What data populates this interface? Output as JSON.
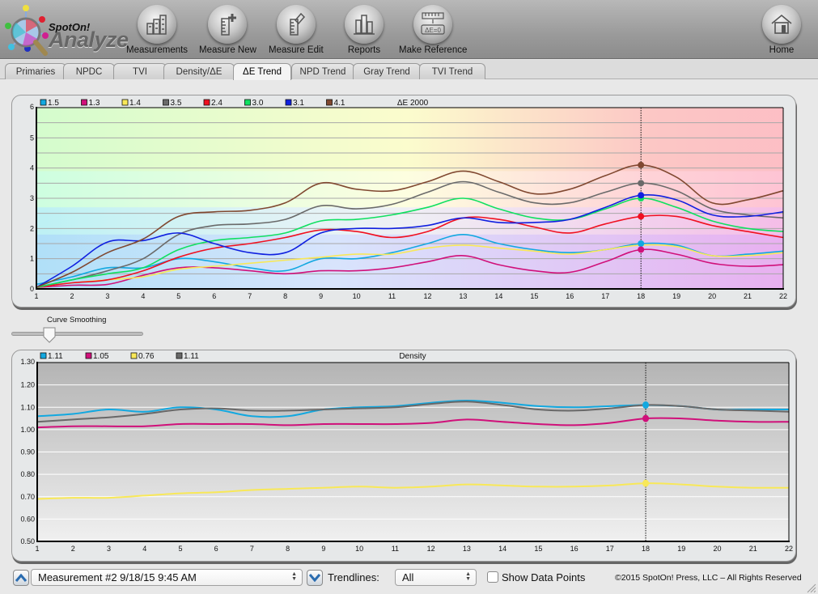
{
  "app": {
    "logo_small": "SpotOn!",
    "logo_large": "Analyze"
  },
  "toolbar": {
    "buttons": [
      {
        "label": "Measurements",
        "icon": "bar-chart-ruler-icon"
      },
      {
        "label": "Measure New",
        "icon": "ruler-plus-icon"
      },
      {
        "label": "Measure Edit",
        "icon": "ruler-pencil-icon"
      },
      {
        "label": "Reports",
        "icon": "bar-chart-icon"
      },
      {
        "label": "Make Reference",
        "icon": "delta-e-zero-icon"
      }
    ],
    "home_label": "Home"
  },
  "tabs": [
    {
      "label": "Primaries",
      "active": false
    },
    {
      "label": "NPDC",
      "active": false
    },
    {
      "label": "TVI",
      "active": false
    },
    {
      "label": "Density/ΔE",
      "active": false
    },
    {
      "label": "ΔE Trend",
      "active": true
    },
    {
      "label": "NPD Trend",
      "active": false
    },
    {
      "label": "Gray Trend",
      "active": false
    },
    {
      "label": "TVI Trend",
      "active": false
    }
  ],
  "controls": {
    "curve_smoothing_label": "Curve Smoothing",
    "curve_smoothing_value": 0.25,
    "measurement_select": "Measurement #2 9/18/15 9:45 AM",
    "trendlines_label": "Trendlines:",
    "trendlines_select": "All",
    "show_data_points_label": "Show Data Points",
    "show_data_points_checked": false,
    "copyright": "©2015 SpotOn! Press, LLC – All Rights Reserved"
  },
  "chart_data": [
    {
      "type": "line",
      "title": "ΔE 2000",
      "xlabel": "",
      "ylabel": "",
      "x": [
        1,
        2,
        3,
        4,
        5,
        6,
        7,
        8,
        9,
        10,
        11,
        12,
        13,
        14,
        15,
        16,
        17,
        18,
        19,
        20,
        21,
        22
      ],
      "xlim": [
        1,
        22
      ],
      "ylim": [
        0,
        6
      ],
      "yticks": [
        0,
        1,
        2,
        3,
        4,
        5,
        6
      ],
      "grid": true,
      "legend": "top-left",
      "selected_x": 18,
      "series": [
        {
          "name": "1.5",
          "color": "#12a8e0",
          "values": [
            0.15,
            0.4,
            0.7,
            0.7,
            1.0,
            0.9,
            0.7,
            0.6,
            1.0,
            1.0,
            1.2,
            1.5,
            1.8,
            1.5,
            1.3,
            1.2,
            1.3,
            1.5,
            1.45,
            1.1,
            1.15,
            1.25
          ]
        },
        {
          "name": "1.3",
          "color": "#d0107a",
          "values": [
            0.05,
            0.12,
            0.15,
            0.45,
            0.7,
            0.7,
            0.6,
            0.5,
            0.6,
            0.6,
            0.7,
            0.9,
            1.1,
            0.8,
            0.6,
            0.55,
            0.9,
            1.3,
            1.15,
            0.85,
            0.75,
            0.8
          ]
        },
        {
          "name": "1.4",
          "color": "#f8e858",
          "values": [
            0.05,
            0.2,
            0.3,
            0.4,
            0.65,
            0.75,
            0.85,
            0.95,
            1.05,
            1.15,
            1.15,
            1.35,
            1.45,
            1.35,
            1.25,
            1.15,
            1.3,
            1.45,
            1.4,
            1.1,
            1.1,
            1.2
          ]
        },
        {
          "name": "3.5",
          "color": "#6a6a6a",
          "values": [
            0.05,
            0.3,
            0.6,
            1.0,
            1.8,
            2.1,
            2.15,
            2.3,
            2.75,
            2.65,
            2.8,
            3.2,
            3.55,
            3.2,
            2.85,
            2.85,
            3.2,
            3.5,
            3.25,
            2.65,
            2.45,
            2.35
          ]
        },
        {
          "name": "2.4",
          "color": "#f01020",
          "values": [
            0.05,
            0.2,
            0.3,
            0.6,
            1.05,
            1.35,
            1.5,
            1.7,
            1.95,
            1.9,
            1.7,
            1.9,
            2.35,
            2.3,
            2.05,
            1.85,
            2.15,
            2.4,
            2.4,
            2.1,
            1.9,
            1.7
          ]
        },
        {
          "name": "3.0",
          "color": "#10e060",
          "values": [
            0.05,
            0.3,
            0.5,
            0.7,
            1.3,
            1.6,
            1.7,
            1.85,
            2.25,
            2.3,
            2.45,
            2.7,
            3.0,
            2.65,
            2.35,
            2.3,
            2.65,
            3.0,
            2.7,
            2.25,
            2.0,
            1.9
          ]
        },
        {
          "name": "3.1",
          "color": "#1020e0",
          "values": [
            0.05,
            0.75,
            1.55,
            1.6,
            1.85,
            1.5,
            1.2,
            1.2,
            1.85,
            2.0,
            2.0,
            2.1,
            2.35,
            2.2,
            2.2,
            2.3,
            2.7,
            3.1,
            2.95,
            2.45,
            2.4,
            2.55
          ]
        },
        {
          "name": "4.1",
          "color": "#804830",
          "values": [
            0.05,
            0.55,
            1.2,
            1.65,
            2.4,
            2.55,
            2.6,
            2.85,
            3.5,
            3.3,
            3.25,
            3.55,
            3.9,
            3.55,
            3.15,
            3.3,
            3.75,
            4.1,
            3.7,
            2.85,
            2.95,
            3.25
          ]
        }
      ]
    },
    {
      "type": "line",
      "title": "Density",
      "xlabel": "",
      "ylabel": "",
      "x": [
        1,
        2,
        3,
        4,
        5,
        6,
        7,
        8,
        9,
        10,
        11,
        12,
        13,
        14,
        15,
        16,
        17,
        18,
        19,
        20,
        21,
        22
      ],
      "xlim": [
        1,
        22
      ],
      "ylim": [
        0.5,
        1.3
      ],
      "yticks": [
        0.5,
        0.6,
        0.7,
        0.8,
        0.9,
        1.0,
        1.1,
        1.2,
        1.3
      ],
      "grid": true,
      "legend": "top-left",
      "selected_x": 18,
      "series": [
        {
          "name": "1.11",
          "color": "#12a8e0",
          "values": [
            1.06,
            1.07,
            1.09,
            1.08,
            1.1,
            1.09,
            1.06,
            1.06,
            1.09,
            1.1,
            1.105,
            1.12,
            1.13,
            1.12,
            1.105,
            1.1,
            1.105,
            1.11,
            1.105,
            1.09,
            1.09,
            1.09
          ]
        },
        {
          "name": "1.05",
          "color": "#d0107a",
          "values": [
            1.01,
            1.015,
            1.015,
            1.015,
            1.025,
            1.025,
            1.025,
            1.02,
            1.025,
            1.025,
            1.025,
            1.03,
            1.045,
            1.035,
            1.025,
            1.02,
            1.03,
            1.05,
            1.05,
            1.04,
            1.035,
            1.035
          ]
        },
        {
          "name": "0.76",
          "color": "#f8e858",
          "values": [
            0.69,
            0.695,
            0.695,
            0.705,
            0.715,
            0.72,
            0.73,
            0.735,
            0.74,
            0.745,
            0.74,
            0.745,
            0.755,
            0.75,
            0.745,
            0.745,
            0.75,
            0.76,
            0.755,
            0.745,
            0.74,
            0.74
          ]
        },
        {
          "name": "1.11",
          "color": "#686868",
          "values": [
            1.035,
            1.045,
            1.055,
            1.07,
            1.09,
            1.095,
            1.085,
            1.085,
            1.09,
            1.095,
            1.1,
            1.115,
            1.125,
            1.11,
            1.09,
            1.085,
            1.095,
            1.11,
            1.105,
            1.09,
            1.085,
            1.08
          ]
        }
      ]
    }
  ]
}
